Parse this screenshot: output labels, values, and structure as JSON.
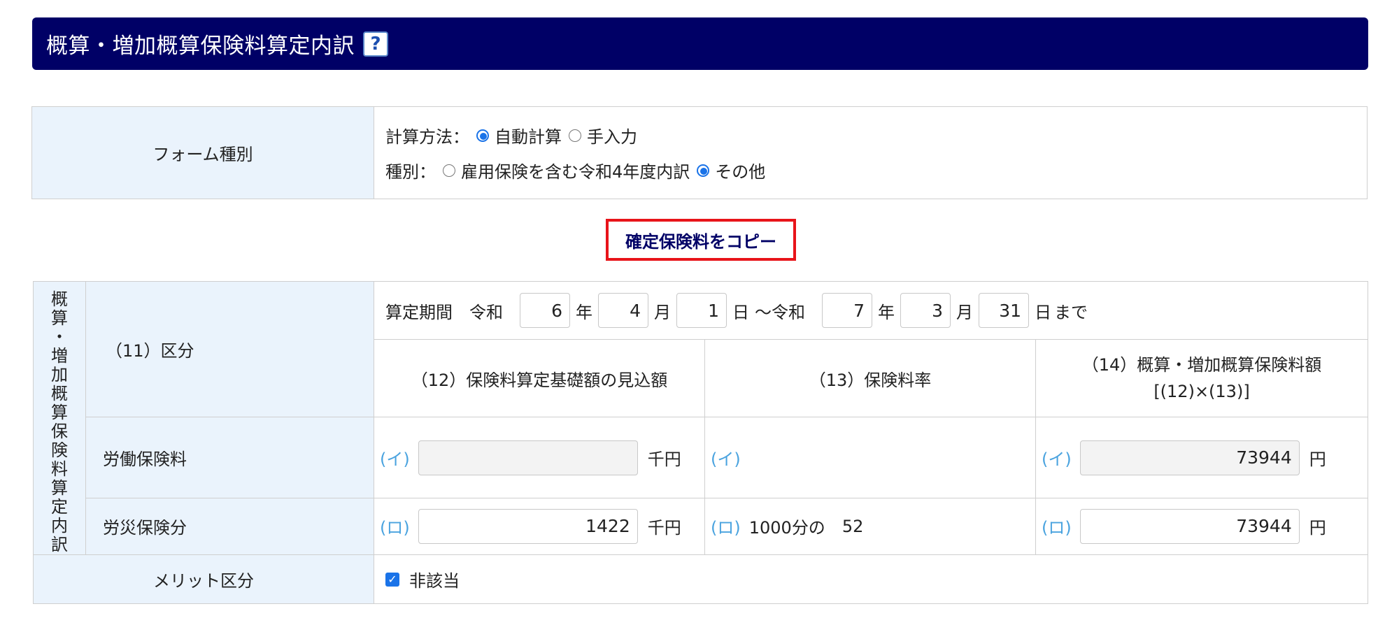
{
  "header": {
    "title": "概算・増加概算保険料算定内訳",
    "help": "?"
  },
  "form_type": {
    "label": "フォーム種別",
    "method_label": "計算方法：",
    "method_options": [
      {
        "label": "自動計算",
        "selected": true
      },
      {
        "label": "手入力",
        "selected": false
      }
    ],
    "kind_label": "種別：",
    "kind_options": [
      {
        "label": "雇用保険を含む令和4年度内訳",
        "selected": false
      },
      {
        "label": "その他",
        "selected": true
      }
    ]
  },
  "copy_button": "確定保険料をコピー",
  "breakdown": {
    "vertical_title": [
      "概",
      "算",
      "・",
      "増",
      "加",
      "概",
      "算",
      "保",
      "険",
      "料",
      "算",
      "定",
      "内",
      "訳"
    ],
    "section_label": "（11）区分",
    "period": {
      "label": "算定期間",
      "era1": "令和",
      "start_year": "6",
      "y1": "年",
      "start_month": "4",
      "m1": "月",
      "start_day": "1",
      "d1": "日",
      "sep": "～令和",
      "end_year": "7",
      "y2": "年",
      "end_month": "3",
      "m2": "月",
      "end_day": "31",
      "d2": "日",
      "until": "まで"
    },
    "col12": "（12）保険料算定基礎額の見込額",
    "col13": "（13）保険料率",
    "col14_line1": "（14）概算・増加概算保険料額",
    "col14_line2": "[(12)×(13)]",
    "rows": [
      {
        "label": "労働保険料",
        "kana": "(イ)",
        "base": "",
        "base_unit": "千円",
        "rate_prefix": "",
        "rate": "",
        "amount": "73944",
        "amount_unit": "円"
      },
      {
        "label": "労災保険分",
        "kana": "(ロ)",
        "base": "1422",
        "base_unit": "千円",
        "rate_prefix": "1000分の",
        "rate": "52",
        "amount": "73944",
        "amount_unit": "円"
      }
    ],
    "merit_label": "メリット区分",
    "merit_check": "非該当"
  }
}
